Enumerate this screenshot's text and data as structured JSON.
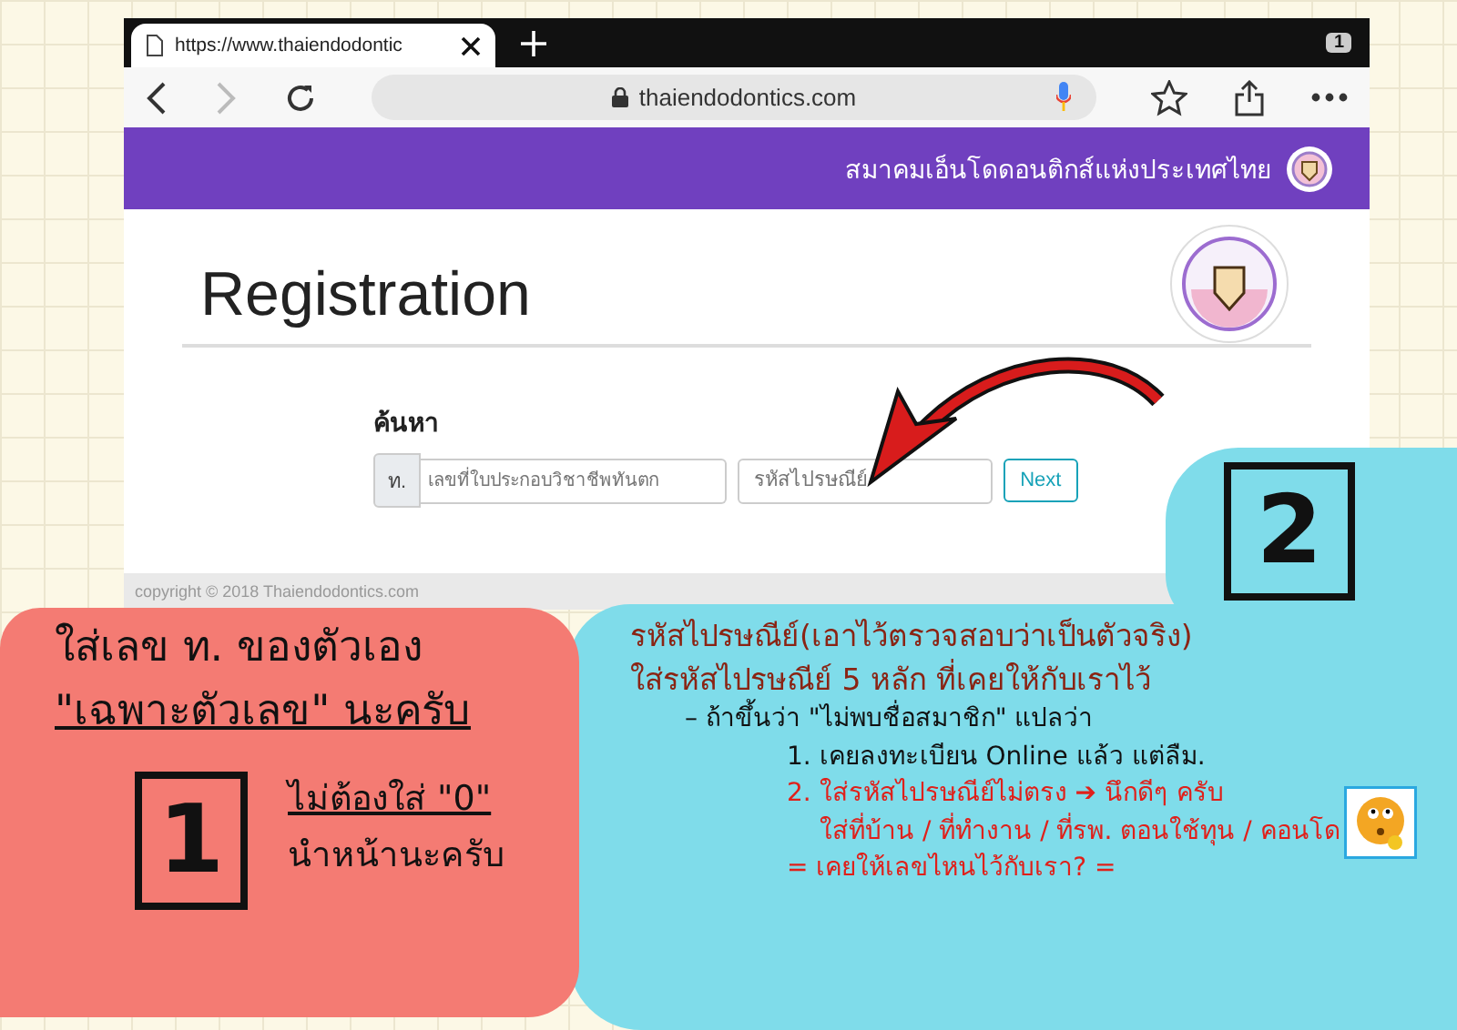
{
  "browser": {
    "tab_title": "https://www.thaiendodontic",
    "tab_count": "1",
    "url": "thaiendodontics.com"
  },
  "site_header": {
    "title": "สมาคมเอ็นโดดอนติกส์แห่งประเทศไทย"
  },
  "page": {
    "heading": "Registration",
    "search_label": "ค้นหา",
    "prefix": "ท.",
    "license_placeholder": "เลขที่ใบประกอบวิชาชีพทันตก",
    "postcode_placeholder": "รหัสไปรษณีย์",
    "next_button": "Next"
  },
  "footer": {
    "copyright": "copyright © 2018 Thaiendodontics.com"
  },
  "notes": [
    {
      "number": "1",
      "color": "#f47b73",
      "lines": [
        {
          "text": "ใส่เลข ท. ของตัวเอง",
          "color": "#111111",
          "underlined": false
        },
        {
          "text": "\"เฉพาะตัวเลข\" นะครับ",
          "color": "#111111",
          "underlined": true
        }
      ],
      "side_lines": [
        {
          "text": "ไม่ต้องใส่ \"0\"",
          "color": "#111111",
          "underlined": true
        },
        {
          "text": "นำหน้านะครับ",
          "color": "#111111",
          "underlined": false
        }
      ]
    },
    {
      "number": "2",
      "color": "#7fdcea",
      "lines": [
        {
          "text": "รหัสไปรษณีย์(เอาไว้ตรวจสอบว่าเป็นตัวจริง)",
          "color": "#8a2414",
          "underlined": false
        },
        {
          "text": "ใส่รหัสไปรษณีย์ 5 หลัก ที่เคยให้กับเราไว้",
          "color": "#8a2414",
          "underlined": false
        },
        {
          "text": "– ถ้าขึ้นว่า \"ไม่พบชื่อสมาชิก\" แปลว่า",
          "color": "#111111",
          "underlined": false
        },
        {
          "text": "1. เคยลงทะเบียน Online แล้ว แต่ลืม.",
          "color": "#111111",
          "underlined": false
        },
        {
          "text": "2. ใส่รหัสไปรษณีย์ไม่ตรง ➔ นึกดีๆ ครับ",
          "color": "#e0201a",
          "underlined": false
        },
        {
          "text": "ใส่ที่บ้าน / ที่ทำงาน / ที่รพ. ตอนใช้ทุน / คอนโด",
          "color": "#e0201a",
          "underlined": false
        },
        {
          "text": "= เคยให้เลขไหนไว้กับเรา? =",
          "color": "#e0201a",
          "underlined": false
        }
      ]
    }
  ]
}
